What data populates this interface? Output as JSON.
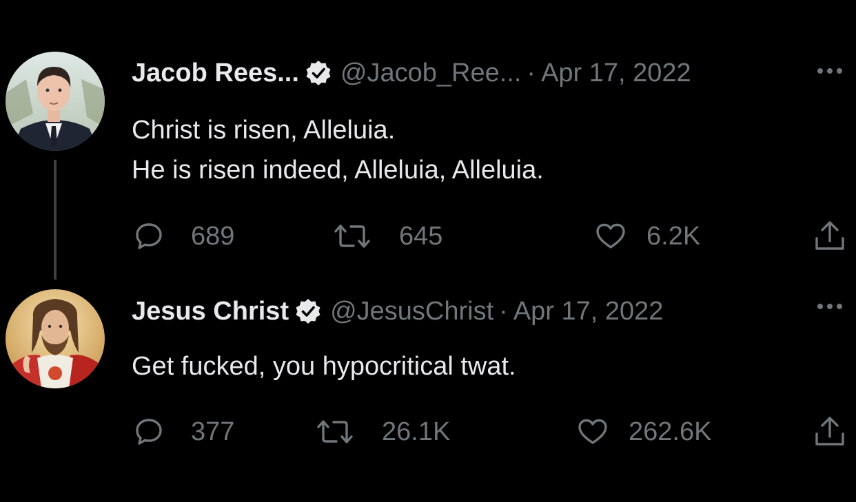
{
  "tweets": [
    {
      "name": "Jacob Rees...",
      "handle": "@Jacob_Ree...",
      "separator": "·",
      "date": "Apr 17, 2022",
      "text_lines": [
        "Christ is risen, Alleluia.",
        "He is risen indeed, Alleluia, Alleluia."
      ],
      "replies": "689",
      "retweets": "645",
      "likes": "6.2K",
      "verified": true,
      "avatar_icon": "man-in-suit-avatar"
    },
    {
      "name": "Jesus Christ",
      "handle": "@JesusChrist",
      "separator": "·",
      "date": "Apr 17, 2022",
      "text_lines": [
        "Get fucked, you hypocritical twat."
      ],
      "replies": "377",
      "retweets": "26.1K",
      "likes": "262.6K",
      "verified": true,
      "avatar_icon": "jesus-painting-avatar"
    }
  ],
  "icons": {
    "reply": "speech-bubble-icon",
    "retweet": "retweet-arrows-icon",
    "like": "heart-icon",
    "share": "share-upload-icon",
    "more": "more-dots-icon",
    "verified": "verified-badge-icon"
  },
  "colors": {
    "background": "#000000",
    "primary_text": "#e7e9ea",
    "secondary_text": "#71767b",
    "thread_line": "#3e4144"
  }
}
